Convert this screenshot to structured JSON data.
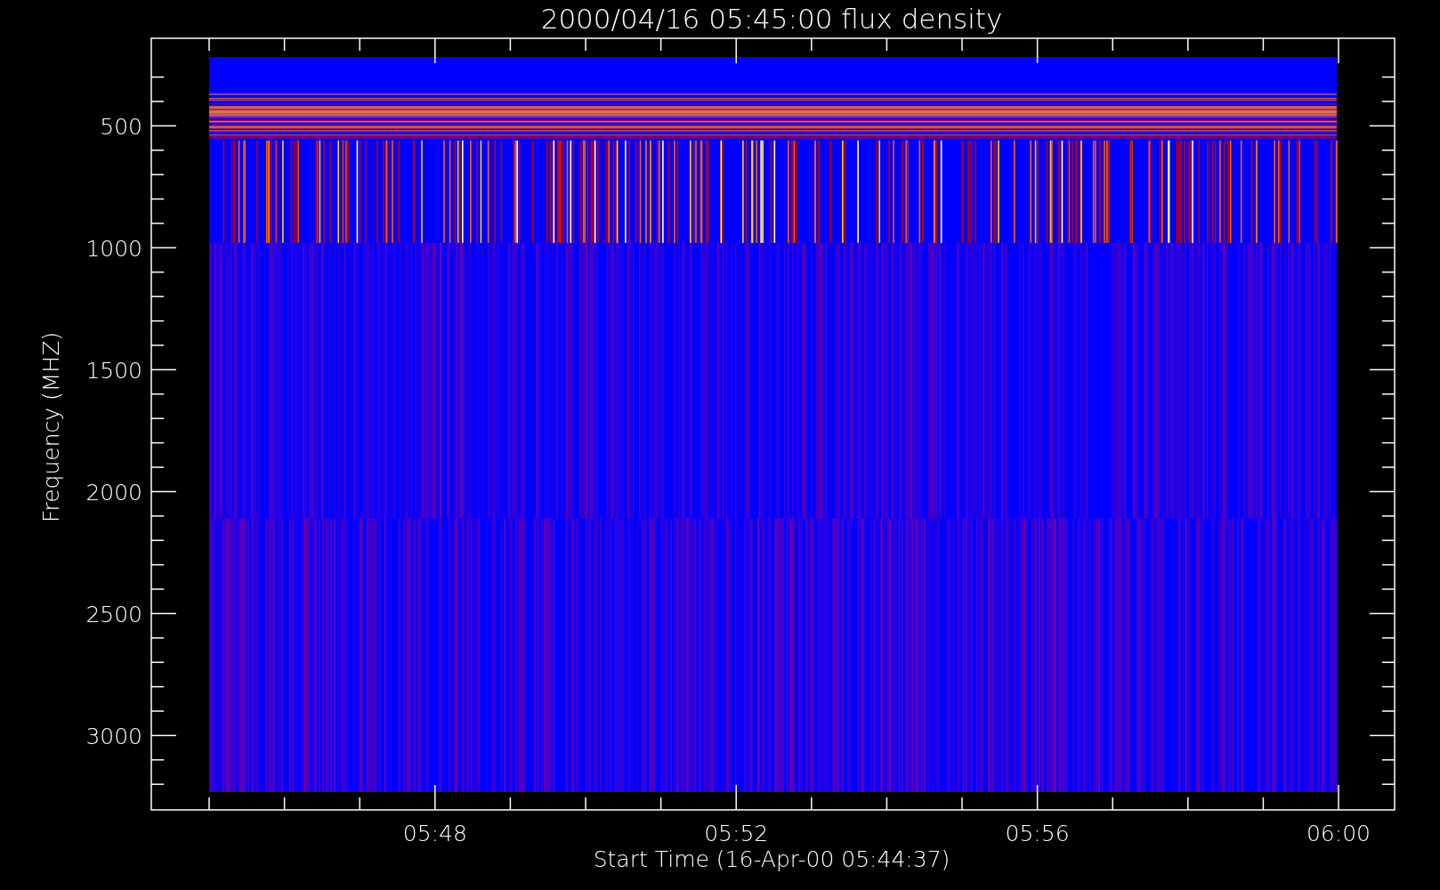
{
  "title": "2000/04/16 05:45:00 flux density",
  "y_axis": {
    "title": "Frequency (MHZ)",
    "tick_labels": [
      "500",
      "1000",
      "1500",
      "2000",
      "2500",
      "3000"
    ]
  },
  "x_axis": {
    "title": "Start Time (16-Apr-00 05:44:37)",
    "tick_labels": [
      "05:48",
      "05:52",
      "05:56",
      "06:00"
    ]
  }
}
